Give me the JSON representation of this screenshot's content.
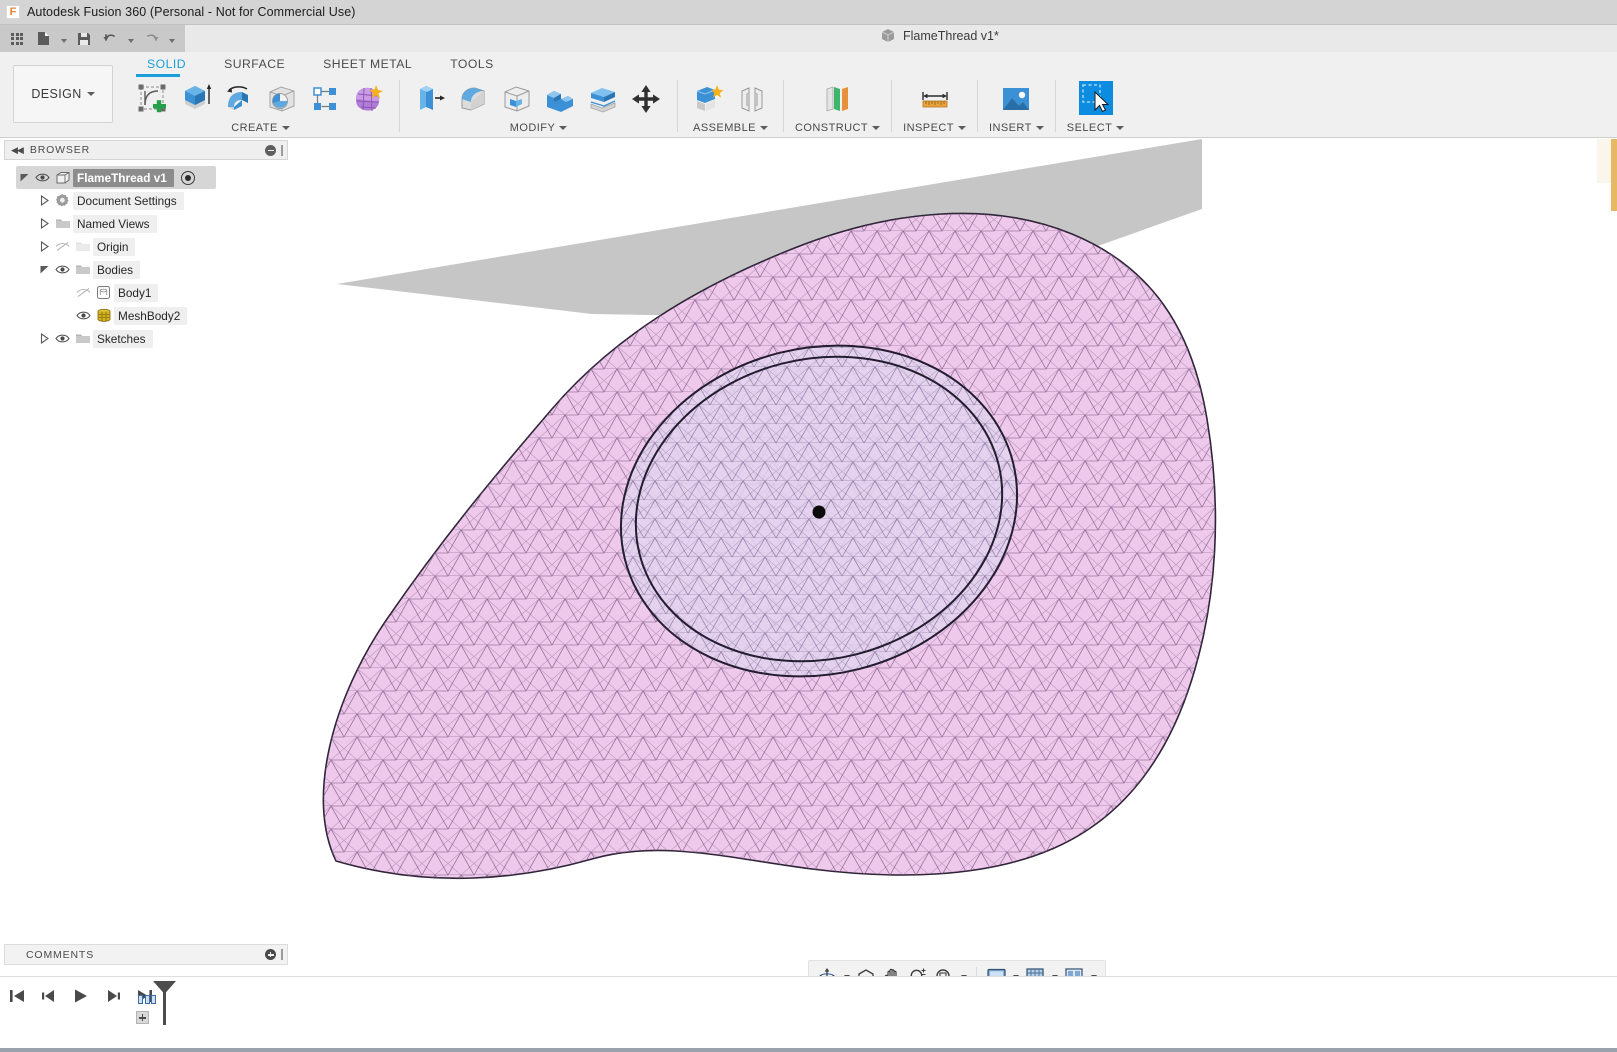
{
  "window": {
    "title": "Autodesk Fusion 360 (Personal - Not for Commercial Use)",
    "logo_icon": "fusion-f-icon"
  },
  "quick_access": {
    "items": [
      {
        "name": "app-grid",
        "icon": "grid-icon",
        "has_caret": false
      },
      {
        "name": "new-document",
        "icon": "file-icon",
        "has_caret": true
      },
      {
        "name": "save",
        "icon": "floppy-disk-icon",
        "has_caret": false
      },
      {
        "name": "undo",
        "icon": "undo-arrow-icon",
        "has_caret": true
      },
      {
        "name": "redo",
        "icon": "redo-arrow-icon",
        "has_caret": true
      }
    ]
  },
  "document_tab": {
    "label": "FlameThread v1*",
    "icon": "cube-icon"
  },
  "workspace": {
    "label": "DESIGN"
  },
  "ribbon": {
    "tabs": [
      {
        "label": "SOLID",
        "active": true
      },
      {
        "label": "SURFACE",
        "active": false
      },
      {
        "label": "SHEET METAL",
        "active": false
      },
      {
        "label": "TOOLS",
        "active": false
      }
    ],
    "active_tab_color": "#1a9fd9",
    "panels": [
      {
        "title": "CREATE",
        "has_caret": true,
        "tools": [
          {
            "name": "create-sketch",
            "icon": "sketch-plus-icon"
          },
          {
            "name": "extrude",
            "icon": "extrude-icon"
          },
          {
            "name": "revolve",
            "icon": "revolve-icon"
          },
          {
            "name": "sweep",
            "icon": "sphere-cube-icon"
          },
          {
            "name": "pattern",
            "icon": "pattern-nodes-icon"
          },
          {
            "name": "form",
            "icon": "form-sculpt-icon"
          }
        ]
      },
      {
        "title": "MODIFY",
        "has_caret": true,
        "tools": [
          {
            "name": "press-pull",
            "icon": "press-pull-icon"
          },
          {
            "name": "fillet",
            "icon": "fillet-icon"
          },
          {
            "name": "shell",
            "icon": "shell-icon"
          },
          {
            "name": "combine",
            "icon": "combine-icon"
          },
          {
            "name": "split-body",
            "icon": "split-body-icon"
          },
          {
            "name": "move-copy",
            "icon": "move-arrows-icon"
          }
        ]
      },
      {
        "title": "ASSEMBLE",
        "has_caret": true,
        "tools": [
          {
            "name": "new-component",
            "icon": "new-component-icon"
          },
          {
            "name": "joint",
            "icon": "joint-icon"
          }
        ]
      },
      {
        "title": "CONSTRUCT",
        "has_caret": true,
        "tools": [
          {
            "name": "offset-plane",
            "icon": "offset-plane-icon"
          }
        ]
      },
      {
        "title": "INSPECT",
        "has_caret": true,
        "tools": [
          {
            "name": "measure",
            "icon": "ruler-measure-icon"
          }
        ]
      },
      {
        "title": "INSERT",
        "has_caret": true,
        "tools": [
          {
            "name": "insert-image",
            "icon": "photo-icon"
          }
        ]
      },
      {
        "title": "SELECT",
        "has_caret": true,
        "tools": [
          {
            "name": "select-tool",
            "icon": "marquee-cursor-icon"
          }
        ]
      }
    ]
  },
  "browser": {
    "header_label": "BROWSER",
    "collapse_icon": "double-left-arrow-icon",
    "minimize_icon": "minus-circle-icon",
    "tree": [
      {
        "label": "FlameThread v1",
        "indent": 0,
        "twist": "expanded",
        "eye": "visible",
        "icon": "component-icon",
        "root": true,
        "radio": true
      },
      {
        "label": "Document Settings",
        "indent": 1,
        "twist": "collapsed",
        "eye": "none",
        "icon": "gear-icon"
      },
      {
        "label": "Named Views",
        "indent": 1,
        "twist": "collapsed",
        "eye": "none",
        "icon": "folder-icon"
      },
      {
        "label": "Origin",
        "indent": 1,
        "twist": "collapsed",
        "eye": "hidden",
        "icon": "folder-icon"
      },
      {
        "label": "Bodies",
        "indent": 1,
        "twist": "expanded",
        "eye": "visible",
        "icon": "folder-icon"
      },
      {
        "label": "Body1",
        "indent": 2,
        "twist": "none",
        "eye": "hidden",
        "icon": "body-icon"
      },
      {
        "label": "MeshBody2",
        "indent": 2,
        "twist": "none",
        "eye": "visible",
        "icon": "mesh-body-icon"
      },
      {
        "label": "Sketches",
        "indent": 1,
        "twist": "collapsed",
        "eye": "visible",
        "icon": "folder-icon"
      }
    ]
  },
  "viewport": {
    "body_fill": "#eec9ec",
    "body_fill_inner": "#e0d2ef",
    "mesh_edge_color": "#6b4a72",
    "outline_color": "#2b2438",
    "shadow_color": "#c4c4c4",
    "accent_marker_color": "#e8b964",
    "origin_point": "origin-point-marker"
  },
  "view_toolbar": {
    "items": [
      {
        "name": "orbit",
        "icon": "orbit-icon",
        "has_caret": true
      },
      {
        "name": "look-at",
        "icon": "look-at-icon",
        "has_caret": false
      },
      {
        "name": "pan",
        "icon": "hand-pan-icon",
        "has_caret": false
      },
      {
        "name": "zoom",
        "icon": "zoom-magnifier-icon",
        "has_caret": false
      },
      {
        "name": "fit",
        "icon": "zoom-fit-icon",
        "has_caret": true
      },
      {
        "name": "display-settings",
        "icon": "monitor-display-icon",
        "has_caret": true
      },
      {
        "name": "grid-snaps",
        "icon": "grid-snap-icon",
        "has_caret": true
      },
      {
        "name": "viewports",
        "icon": "multiple-views-icon",
        "has_caret": true
      }
    ]
  },
  "comments": {
    "header_label": "COMMENTS",
    "add_icon": "plus-circle-icon"
  },
  "timeline": {
    "controls": [
      {
        "name": "jump-to-beginning",
        "icon": "skip-back-icon"
      },
      {
        "name": "step-back",
        "icon": "step-back-icon"
      },
      {
        "name": "play",
        "icon": "play-icon"
      },
      {
        "name": "step-forward",
        "icon": "step-forward-icon"
      },
      {
        "name": "jump-to-end",
        "icon": "skip-forward-icon"
      }
    ],
    "feature_chips": 3,
    "playhead_icon": "timeline-marker-icon",
    "add_icon": "timeline-add-icon"
  }
}
